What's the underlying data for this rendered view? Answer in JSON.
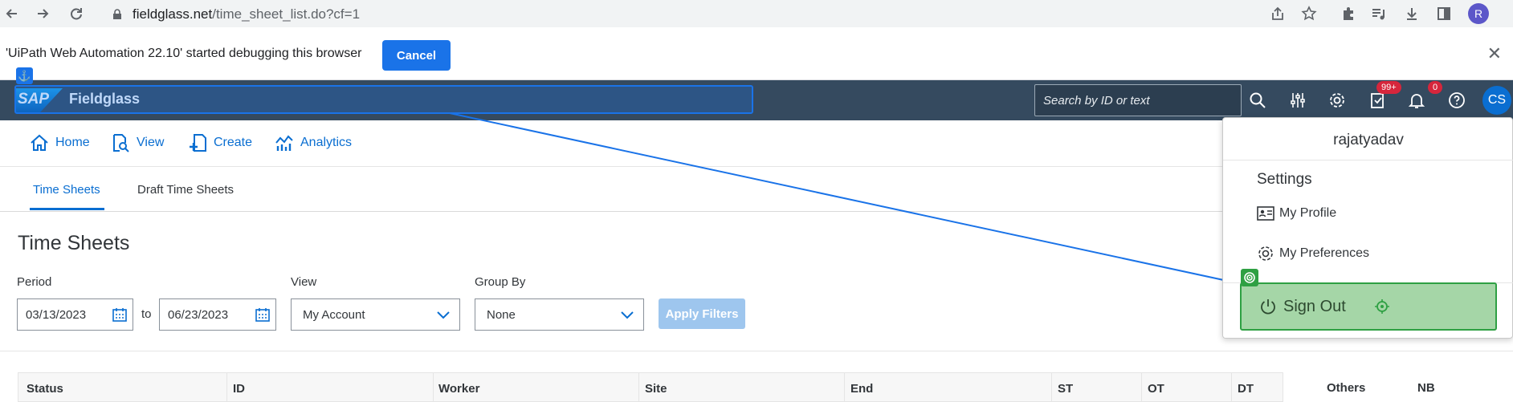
{
  "browser": {
    "url_host": "fieldglass.net",
    "url_path": "/time_sheet_list.do?cf=1",
    "profile_initial": "R"
  },
  "debugbar": {
    "message": "'UiPath Web Automation 22.10' started debugging this browser",
    "cancel_label": "Cancel"
  },
  "shell": {
    "logo_text": "SAP",
    "brand": "Fieldglass",
    "search_placeholder": "Search by ID or text",
    "tasks_badge": "99+",
    "notifications_badge": "0",
    "avatar_initials": "CS"
  },
  "nav": {
    "items": [
      {
        "label": "Home",
        "icon": "home-icon"
      },
      {
        "label": "View",
        "icon": "view-icon"
      },
      {
        "label": "Create",
        "icon": "create-icon"
      },
      {
        "label": "Analytics",
        "icon": "analytics-icon"
      }
    ]
  },
  "tabs": [
    {
      "label": "Time Sheets",
      "active": true
    },
    {
      "label": "Draft Time Sheets",
      "active": false
    }
  ],
  "main": {
    "title": "Time Sheets",
    "period_label": "Period",
    "period_from": "03/13/2023",
    "to_label": "to",
    "period_to": "06/23/2023",
    "view_label": "View",
    "view_value": "My Account",
    "groupby_label": "Group By",
    "groupby_value": "None",
    "apply_label": "Apply Filters"
  },
  "table": {
    "columns": [
      "Status",
      "ID",
      "Worker",
      "Site",
      "End",
      "ST",
      "OT",
      "DT",
      "Others",
      "NB"
    ]
  },
  "menu": {
    "username": "rajatyadav",
    "settings_label": "Settings",
    "my_profile": "My Profile",
    "my_preferences": "My Preferences",
    "sign_out": "Sign Out"
  },
  "colors": {
    "shell": "#354a5f",
    "accent": "#0a6ed1",
    "uipath_blue": "#1a73e8",
    "uipath_green": "#2ea043"
  }
}
